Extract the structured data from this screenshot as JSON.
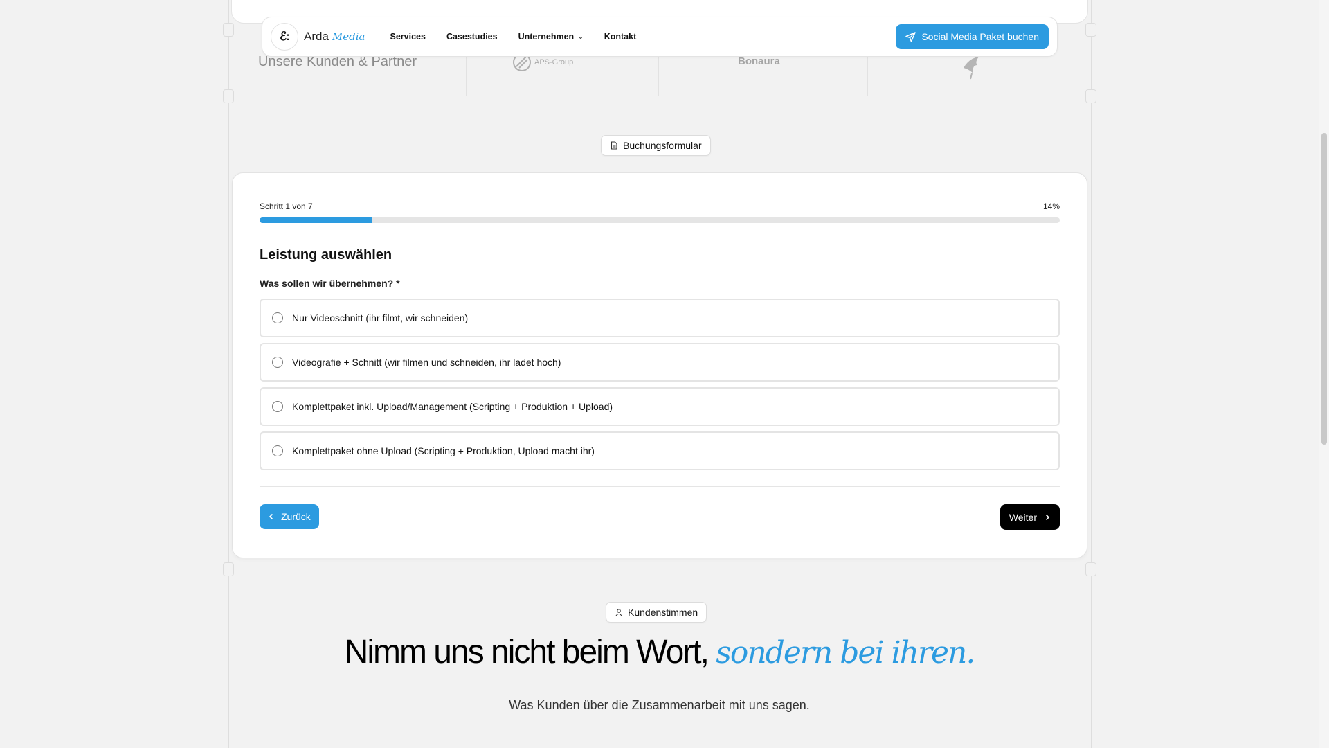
{
  "header": {
    "brand_name": "Arda",
    "brand_accent": "Media",
    "logo_glyph": "ℰ:",
    "nav": [
      {
        "label": "Services"
      },
      {
        "label": "Casestudies"
      },
      {
        "label": "Unternehmen"
      },
      {
        "label": "Kontakt"
      }
    ],
    "cta_label": "Social Media Paket buchen"
  },
  "partners": {
    "label": "Unsere Kunden & Partner",
    "logos": [
      "APS-Group",
      "Bonaura",
      "bird-logo"
    ]
  },
  "form_badge": {
    "label": "Buchungsformular",
    "icon": "document-icon"
  },
  "form": {
    "step_text": "Schritt 1 von 7",
    "percent_text": "14%",
    "progress": 0.14,
    "title": "Leistung auswählen",
    "question": "Was sollen wir übernehmen? *",
    "options": [
      {
        "label": "Nur Videoschnitt (ihr filmt, wir schneiden)"
      },
      {
        "label": "Videografie + Schnitt (wir filmen und schneiden, ihr ladet hoch)"
      },
      {
        "label": "Komplettpaket inkl. Upload/Management (Scripting + Produktion + Upload)"
      },
      {
        "label": "Komplettpaket ohne Upload (Scripting + Produktion, Upload macht ihr)"
      }
    ],
    "back_label": "Zurück",
    "next_label": "Weiter"
  },
  "testimonials": {
    "badge_label": "Kundenstimmen",
    "badge_icon": "user-icon",
    "headline_main": "Nimm uns nicht beim Wort,",
    "headline_accent": "sondern bei ihren.",
    "subline": "Was Kunden über die Zusammenarbeit mit uns sagen."
  },
  "colors": {
    "accent": "#2c9be0",
    "background": "#f2f2f2"
  }
}
